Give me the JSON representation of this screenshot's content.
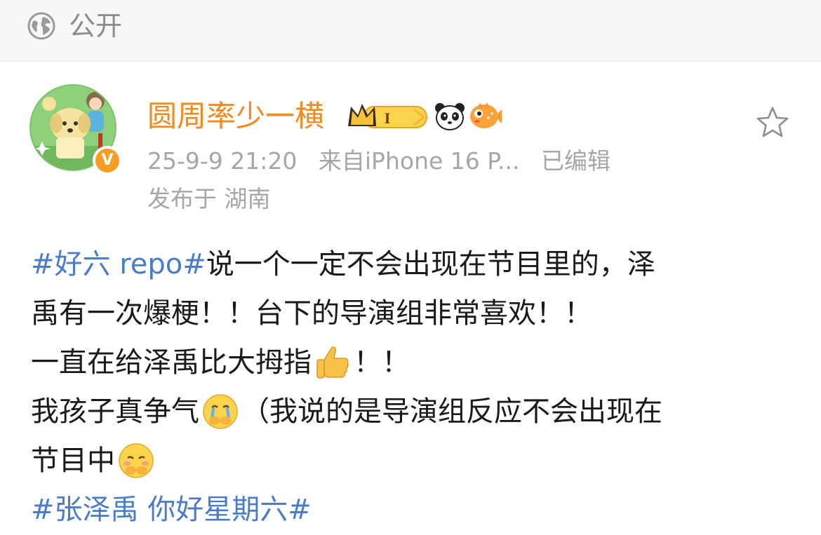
{
  "visibility": {
    "icon": "globe-icon",
    "label": "公开"
  },
  "author": {
    "name": "圆周率少一横",
    "avatar": "avatar-dog-illustration",
    "verified_mark": "V",
    "member_badge_text": "I",
    "icons": [
      "crown-icon",
      "panda-icon",
      "fish-icon"
    ]
  },
  "meta": {
    "timestamp": "25-9-9 21:20",
    "source": "来自iPhone 16 P...",
    "edited": "已编辑",
    "location": "发布于 湖南"
  },
  "actions": {
    "favorite_icon": "star-outline-icon"
  },
  "post": {
    "line1_tag": "#好六 repo#",
    "line1_text": "说一个一定不会出现在节目里的，泽",
    "line2_text": "禹有一次爆梗！！台下的导演组非常喜欢！！",
    "line3_text": "一直在给泽禹比大拇指",
    "line3_suffix": "！！",
    "line4_text": "我孩子真争气",
    "line4_suffix": "（我说的是导演组反应不会出现在",
    "line5_text": "节目中",
    "line6_tag": "#张泽禹 你好星期六#"
  },
  "colors": {
    "username": "#f28a1e",
    "hashtag": "#4a7cc7",
    "meta": "#a6a6a6",
    "badge": "#f79d24"
  }
}
